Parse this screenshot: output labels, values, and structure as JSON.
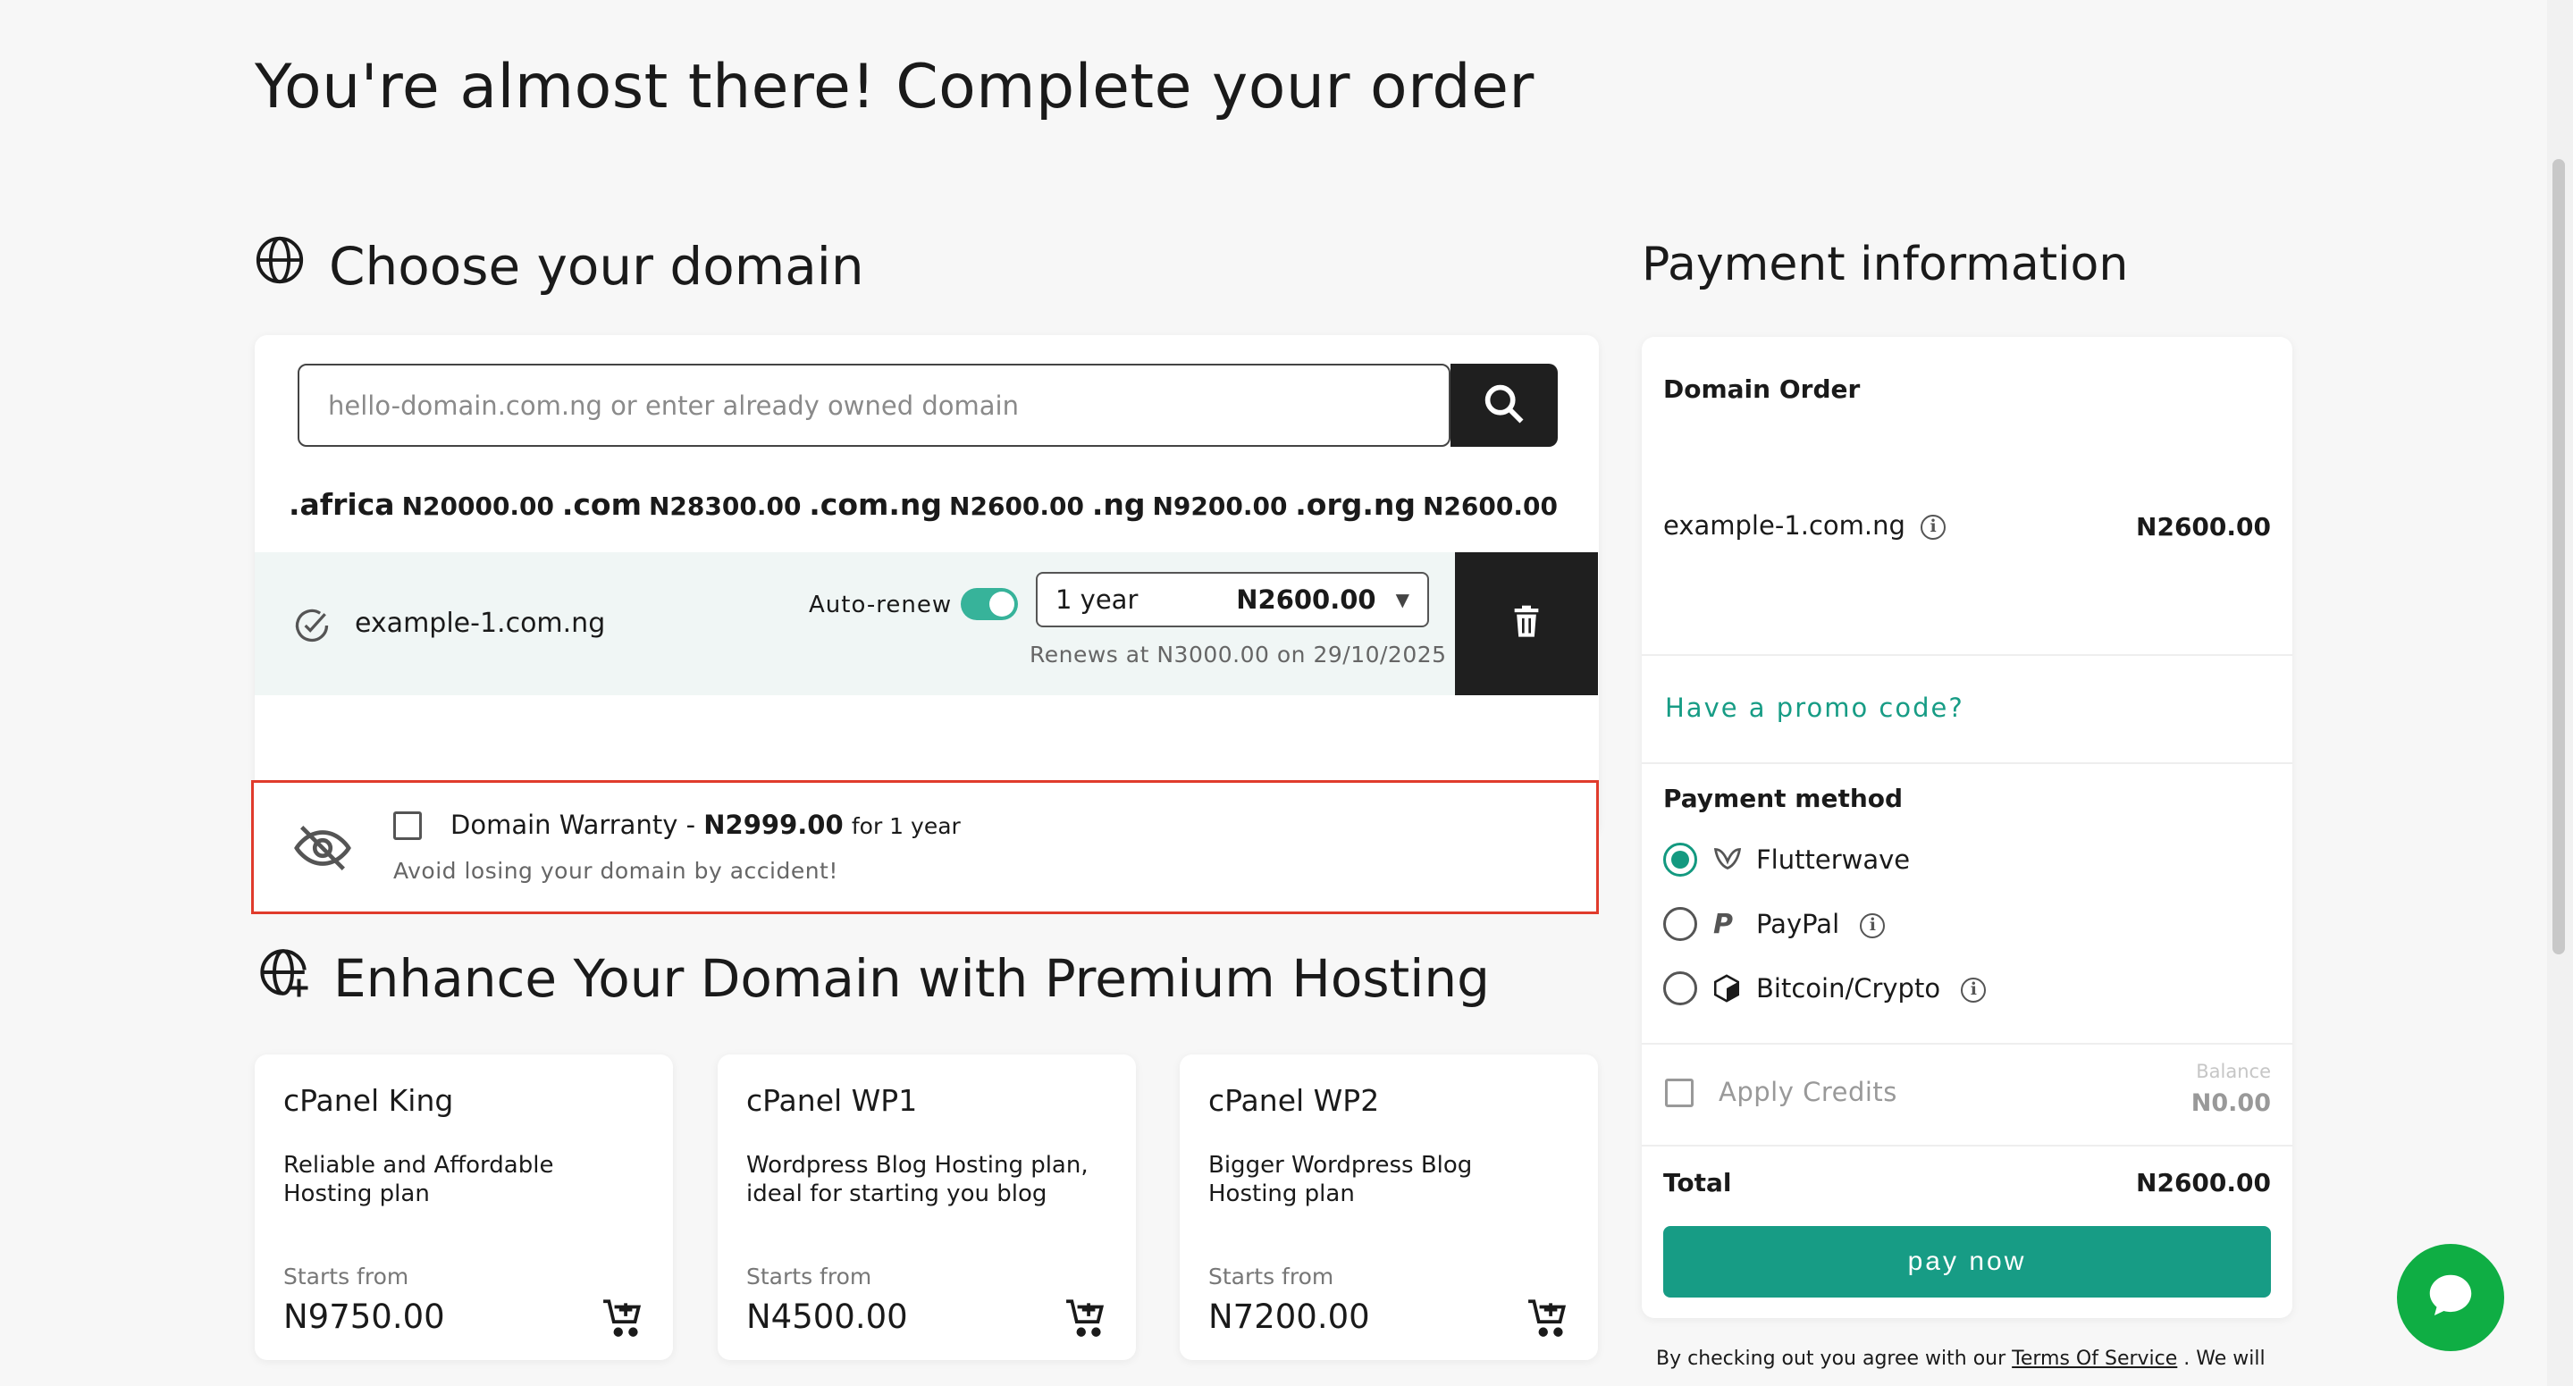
{
  "page": {
    "title": "You're almost there! Complete your order"
  },
  "domain_section": {
    "title": "Choose your domain",
    "search_placeholder": "hello-domain.com.ng or enter already owned domain",
    "tlds": [
      {
        "name": ".africa",
        "price": "N20000.00"
      },
      {
        "name": ".com",
        "price": "N28300.00"
      },
      {
        "name": ".com.ng",
        "price": "N2600.00"
      },
      {
        "name": ".ng",
        "price": "N9200.00"
      },
      {
        "name": ".org.ng",
        "price": "N2600.00"
      }
    ],
    "selected": {
      "domain": "example-1.com.ng",
      "auto_renew_label": "Auto-renew",
      "auto_renew_on": true,
      "period": "1 year",
      "period_price": "N2600.00",
      "renew_note": "Renews at N3000.00 on 29/10/2025"
    },
    "warranty": {
      "label": "Domain Warranty - ",
      "price": "N2999.00",
      "period": "for 1 year",
      "note": "Avoid losing your domain by accident!"
    }
  },
  "hosting_section": {
    "title": "Enhance Your Domain with Premium Hosting",
    "starts_from_label": "Starts from",
    "plans": [
      {
        "name": "cPanel King",
        "desc": "Reliable and Affordable Hosting plan",
        "price": "N9750.00"
      },
      {
        "name": "cPanel WP1",
        "desc": "Wordpress Blog Hosting plan, ideal for starting you blog",
        "price": "N4500.00"
      },
      {
        "name": "cPanel WP2",
        "desc": "Bigger Wordpress Blog Hosting plan",
        "price": "N7200.00"
      }
    ]
  },
  "payment": {
    "title": "Payment information",
    "order_heading": "Domain Order",
    "order_item": "example-1.com.ng",
    "order_price": "N2600.00",
    "promo_link": "Have a promo code?",
    "method_heading": "Payment method",
    "methods": [
      {
        "label": "Flutterwave",
        "selected": true
      },
      {
        "label": "PayPal",
        "selected": false
      },
      {
        "label": "Bitcoin/Crypto",
        "selected": false
      }
    ],
    "credits_label": "Apply Credits",
    "balance_label": "Balance",
    "balance_value": "N0.00",
    "total_label": "Total",
    "total_value": "N2600.00",
    "pay_button": "pay now",
    "terms_prefix": "By checking out you agree with our ",
    "terms_link": "Terms Of Service",
    "terms_suffix": " . We will"
  },
  "colors": {
    "accent": "#179c85",
    "danger_border": "#e03b2c",
    "chat": "#0fae44",
    "dark": "#1f1f1f"
  }
}
